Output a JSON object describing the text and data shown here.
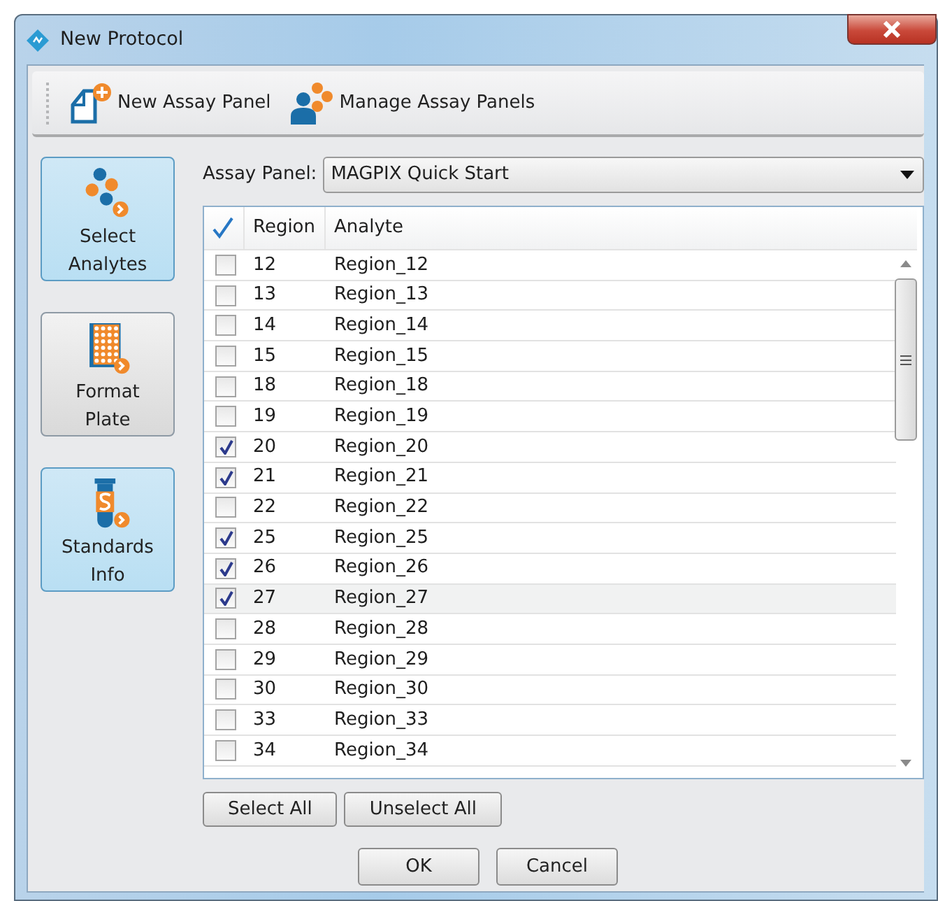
{
  "window": {
    "title": "New Protocol"
  },
  "toolbar": [
    {
      "label": "New Assay Panel",
      "kind": "new"
    },
    {
      "label": "Manage Assay Panels",
      "kind": "manage"
    }
  ],
  "sidebar": {
    "items": [
      {
        "label": "Select Analytes",
        "kind": "analytes",
        "selected": true
      },
      {
        "label": "Format Plate",
        "kind": "plate",
        "selected": false
      },
      {
        "label": "Standards Info",
        "kind": "standards",
        "selected": true
      }
    ]
  },
  "assay_panel": {
    "label": "Assay Panel:",
    "value": "MAGPIX Quick Start"
  },
  "table": {
    "columns": [
      "Region",
      "Analyte"
    ],
    "rows": [
      {
        "region": "12",
        "analyte": "Region_12",
        "checked": false,
        "selected": false
      },
      {
        "region": "13",
        "analyte": "Region_13",
        "checked": false,
        "selected": false
      },
      {
        "region": "14",
        "analyte": "Region_14",
        "checked": false,
        "selected": false
      },
      {
        "region": "15",
        "analyte": "Region_15",
        "checked": false,
        "selected": false
      },
      {
        "region": "18",
        "analyte": "Region_18",
        "checked": false,
        "selected": false
      },
      {
        "region": "19",
        "analyte": "Region_19",
        "checked": false,
        "selected": false
      },
      {
        "region": "20",
        "analyte": "Region_20",
        "checked": true,
        "selected": false
      },
      {
        "region": "21",
        "analyte": "Region_21",
        "checked": true,
        "selected": false
      },
      {
        "region": "22",
        "analyte": "Region_22",
        "checked": false,
        "selected": false
      },
      {
        "region": "25",
        "analyte": "Region_25",
        "checked": true,
        "selected": false
      },
      {
        "region": "26",
        "analyte": "Region_26",
        "checked": true,
        "selected": false
      },
      {
        "region": "27",
        "analyte": "Region_27",
        "checked": true,
        "selected": true
      },
      {
        "region": "28",
        "analyte": "Region_28",
        "checked": false,
        "selected": false
      },
      {
        "region": "29",
        "analyte": "Region_29",
        "checked": false,
        "selected": false
      },
      {
        "region": "30",
        "analyte": "Region_30",
        "checked": false,
        "selected": false
      },
      {
        "region": "33",
        "analyte": "Region_33",
        "checked": false,
        "selected": false
      },
      {
        "region": "34",
        "analyte": "Region_34",
        "checked": false,
        "selected": false
      }
    ]
  },
  "table_buttons": [
    "Select All",
    "Unselect All"
  ],
  "buttons": [
    "OK",
    "Cancel"
  ]
}
